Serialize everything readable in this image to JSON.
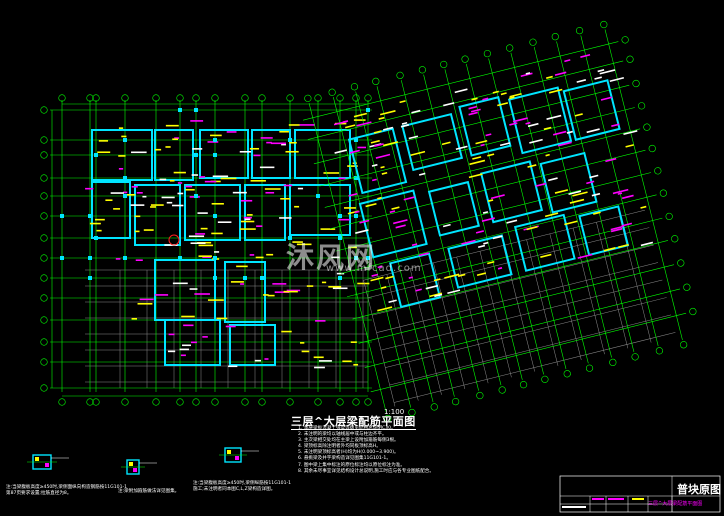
{
  "plan": {
    "title": "三层^大层梁配筋平面图",
    "scale": "1:100"
  },
  "notes": [
    "1. 本层梁板混凝土强度等级见结构总说明C30。",
    "2. 未注明的梁均以轴线居中或与柱边齐平。",
    "3. 主次梁相交处均在主梁上设附加箍筋每侧3根。",
    "4. 梁顶标高除注明者外均同板顶标高H。",
    "5. 未注明梁顶标高者(H)均为H(0.000~3.900)。",
    "6. 悬挑梁及井字梁构造详见图集11G101-1。",
    "7. 图中梁上集中标注的原位标注均以原位标注为准。",
    "8. 其余未尽事宜详见结构设计总说明,施工时应与各专业图纸配合。"
  ],
  "legends": [
    {
      "line1": "注:当梁腹板高度≥450时,梁侧面纵向构造钢筋按11G101-1",
      "line2": "第87页要求设置;拉筋直径为8。"
    },
    {
      "line1": "注:梁附加箍筋做法详见图集。",
      "line2": ""
    },
    {
      "line1": "注:当梁腹板高度≥450时,梁侧纵筋按11G101-1",
      "line2": "施工;未注明者同本图C,L,Z梁构造详图。"
    }
  ],
  "watermark": {
    "text": "沐风网",
    "url": "www.mfcad.com"
  },
  "title_block": {
    "drawing_name": "普块原图",
    "label": "三层^大层梁配筋平面图"
  },
  "colors": {
    "grid": "#00ff00",
    "column": "#00e5ff",
    "label_yellow": "#ffff00",
    "label_magenta": "#ff00ff",
    "text": "#ffffff",
    "grey": "#8c8c8c"
  }
}
